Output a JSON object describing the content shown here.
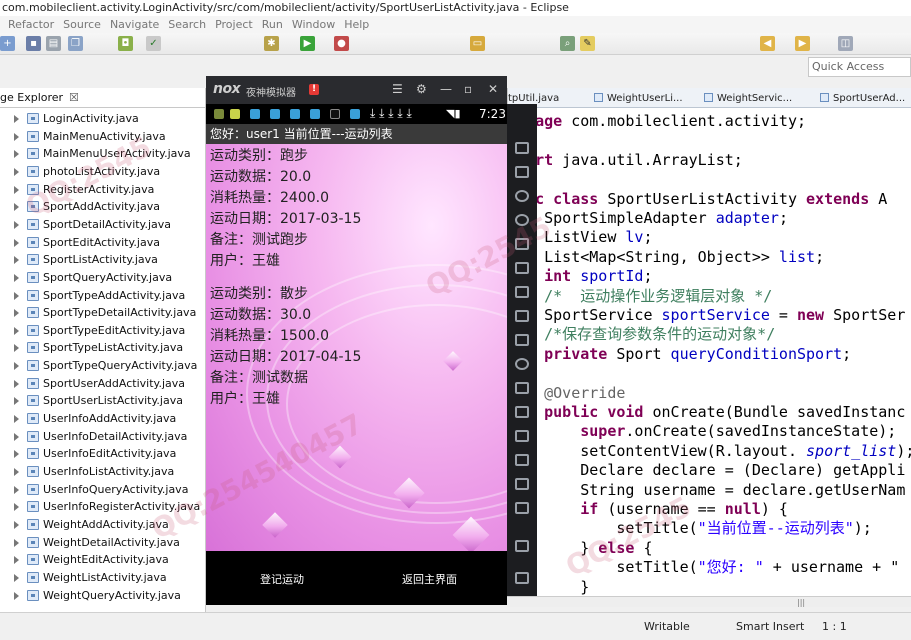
{
  "window": {
    "title": "com.mobileclient.activity.LoginActivity/src/com/mobileclient/activity/SportUserListActivity.java - Eclipse"
  },
  "menu": [
    "Refactor",
    "Source",
    "Navigate",
    "Search",
    "Project",
    "Run",
    "Window",
    "Help"
  ],
  "quick_access": {
    "placeholder": "Quick Access"
  },
  "package_explorer": {
    "tab_label": "ge Explorer",
    "close": "☒",
    "files": [
      "LoginActivity.java",
      "MainMenuActivity.java",
      "MainMenuUserActivity.java",
      "photoListActivity.java",
      "RegisterActivity.java",
      "SportAddActivity.java",
      "SportDetailActivity.java",
      "SportEditActivity.java",
      "SportListActivity.java",
      "SportQueryActivity.java",
      "SportTypeAddActivity.java",
      "SportTypeDetailActivity.java",
      "SportTypeEditActivity.java",
      "SportTypeListActivity.java",
      "SportTypeQueryActivity.java",
      "SportUserAddActivity.java",
      "SportUserListActivity.java",
      "UserInfoAddActivity.java",
      "UserInfoDetailActivity.java",
      "UserInfoEditActivity.java",
      "UserInfoListActivity.java",
      "UserInfoQueryActivity.java",
      "UserInfoRegisterActivity.java",
      "WeightAddActivity.java",
      "WeightDetailActivity.java",
      "WeightEditActivity.java",
      "WeightListActivity.java",
      "WeightQueryActivity.java"
    ],
    "selected_index": 16
  },
  "editor": {
    "tabs": [
      "tpUtil.java",
      "WeightUserLi...",
      "WeightServic...",
      "SportUserAd..."
    ],
    "lines": [
      {
        "parts": [
          [
            "kw",
            "ackage"
          ],
          [
            "",
            "com.mobileclient.activity;"
          ]
        ]
      },
      {
        "parts": []
      },
      {
        "parts": [
          [
            "kw",
            "mport"
          ],
          [
            "",
            "java.util.ArrayList;"
          ]
        ]
      },
      {
        "parts": []
      },
      {
        "parts": [
          [
            "kw",
            "blic"
          ],
          [
            "",
            ""
          ],
          [
            "kw",
            "class"
          ],
          [
            "",
            "SportUserListActivity"
          ],
          [
            "kw",
            "extends"
          ],
          [
            "",
            "A"
          ]
        ]
      },
      {
        "parts": [
          [
            "",
            "    SportSimpleAdapter"
          ],
          [
            "fld",
            "adapter"
          ],
          [
            "",
            ";"
          ]
        ]
      },
      {
        "parts": [
          [
            "",
            "    ListView"
          ],
          [
            "fld",
            "lv"
          ],
          [
            "",
            ";"
          ]
        ]
      },
      {
        "parts": [
          [
            "",
            "    List<Map<String, Object>>"
          ],
          [
            "fld",
            "list"
          ],
          [
            "",
            ";"
          ]
        ]
      },
      {
        "parts": [
          [
            "kw",
            "    int"
          ],
          [
            "fld",
            "sportId"
          ],
          [
            "",
            ";"
          ]
        ]
      },
      {
        "parts": [
          [
            "cm",
            "    /*  运动操作业务逻辑层对象 */"
          ]
        ]
      },
      {
        "parts": [
          [
            "",
            "    SportService"
          ],
          [
            "fld",
            "sportService"
          ],
          [
            "",
            " ="
          ],
          [
            "kw",
            "new"
          ],
          [
            "",
            "SportSer"
          ]
        ]
      },
      {
        "parts": [
          [
            "cm",
            "    /*保存查询参数条件的运动对象*/"
          ]
        ]
      },
      {
        "parts": [
          [
            "kw",
            "    private"
          ],
          [
            "",
            "Sport"
          ],
          [
            "fld",
            "queryConditionSport"
          ],
          [
            "",
            ";"
          ]
        ]
      },
      {
        "parts": []
      },
      {
        "parts": [
          [
            "an",
            "    @Override"
          ]
        ]
      },
      {
        "parts": [
          [
            "kw",
            "    public"
          ],
          [
            "kw",
            "void"
          ],
          [
            "",
            "onCreate(Bundle savedInstanc"
          ]
        ]
      },
      {
        "parts": [
          [
            "kw",
            "        super"
          ],
          [
            "",
            ".onCreate(savedInstanceState);"
          ]
        ]
      },
      {
        "parts": [
          [
            "",
            "        setContentView(R.layout."
          ],
          [
            "it",
            "sport_list"
          ],
          [
            "",
            ");"
          ]
        ]
      },
      {
        "parts": [
          [
            "",
            "        Declare declare = (Declare) getAppli"
          ]
        ]
      },
      {
        "parts": [
          [
            "",
            "        String username = declare.getUserNam"
          ]
        ]
      },
      {
        "parts": [
          [
            "kw",
            "        if"
          ],
          [
            "",
            " (username =="
          ],
          [
            "kw",
            "null"
          ],
          [
            "",
            ") {"
          ]
        ]
      },
      {
        "parts": [
          [
            "",
            "            setTitle("
          ],
          [
            "st",
            "\"当前位置--运动列表\""
          ],
          [
            "",
            ");"
          ]
        ]
      },
      {
        "parts": [
          [
            "",
            "        }"
          ],
          [
            "kw",
            "else"
          ],
          [
            "",
            "{"
          ]
        ]
      },
      {
        "parts": [
          [
            "",
            "            setTitle("
          ],
          [
            "st",
            "\"您好: \""
          ],
          [
            "",
            " + username + \""
          ]
        ]
      },
      {
        "parts": [
          [
            "",
            "        }"
          ]
        ]
      }
    ]
  },
  "status": {
    "writable": "Writable",
    "insert": "Smart Insert",
    "pos": "1 : 1"
  },
  "emulator": {
    "brand": "nox",
    "name": "夜神模拟器",
    "time": "7:23",
    "app_title": "您好：user1  当前位置---运动列表",
    "records": [
      {
        "type": "运动类别：跑步",
        "data": "运动数据：20.0",
        "cal": "消耗热量：2400.0",
        "date": "运动日期：2017-03-15",
        "note": "备注：测试跑步",
        "user": "用户：王雄"
      },
      {
        "type": "运动类别：散步",
        "data": "运动数据：30.0",
        "cal": "消耗热量：1500.0",
        "date": "运动日期：2017-04-15",
        "note": "备注：测试数据",
        "user": "用户：王雄"
      }
    ],
    "btn_register": "登记运动",
    "btn_back": "返回主界面"
  }
}
